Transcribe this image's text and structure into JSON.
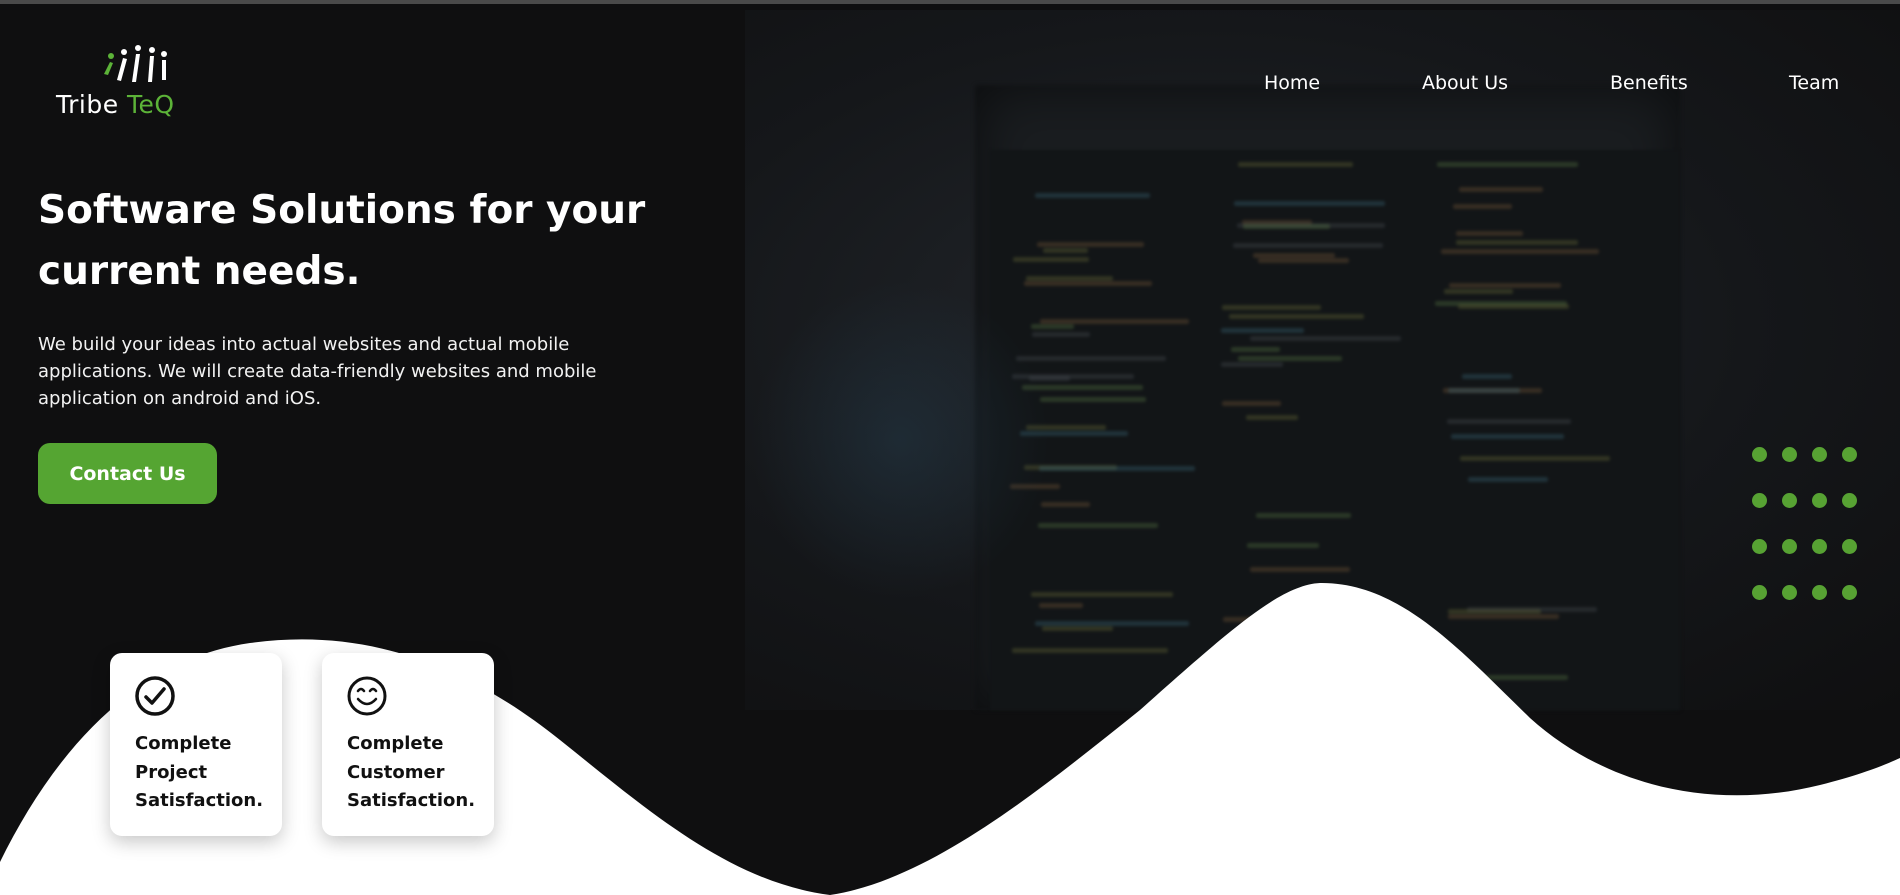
{
  "brand": {
    "name_part1": "Tribe ",
    "name_part2": "TeQ",
    "accent_color": "#5cb338",
    "logo_icon": "tribe-figures-icon"
  },
  "nav": {
    "items": [
      {
        "label": "Home"
      },
      {
        "label": "About Us"
      },
      {
        "label": "Benefits"
      },
      {
        "label": "Team"
      }
    ]
  },
  "hero": {
    "title": "Software Solutions for your current needs.",
    "description": "We build your ideas into actual websites and actual mobile applications. We will create data-friendly websites and mobile application on android and iOS.",
    "cta_label": "Contact Us",
    "cta_color": "#55a532"
  },
  "cards": [
    {
      "icon": "check-circle-icon",
      "text": "Complete Project Satisfaction."
    },
    {
      "icon": "smiley-face-icon",
      "text": "Complete Customer Satisfaction."
    }
  ],
  "colors": {
    "background": "#0f0f10",
    "dots": "#57a233",
    "wave": "#ffffff"
  }
}
